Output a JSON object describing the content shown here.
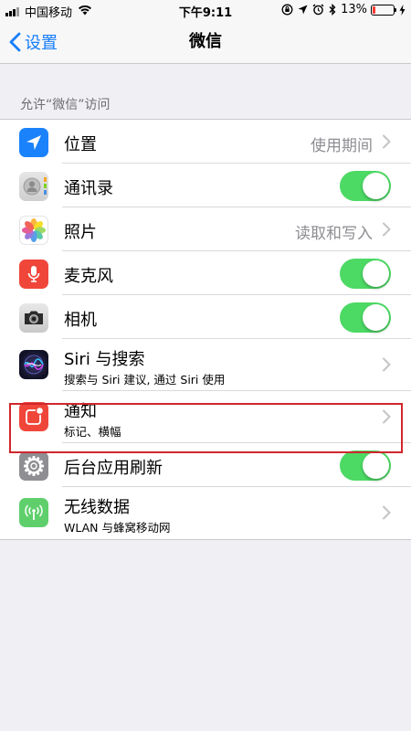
{
  "status_bar": {
    "carrier": "中国移动",
    "time": "下午9:11",
    "battery_percent": "13%",
    "battery_level": 0.13,
    "battery_color": "#ff3b30"
  },
  "nav": {
    "back_label": "设置",
    "title": "微信"
  },
  "section": {
    "header": "允许“微信”访问"
  },
  "rows": [
    {
      "title": "位置",
      "detail": "使用期间",
      "icon": "location-arrow-icon",
      "icon_color": "#1a82fb"
    },
    {
      "title": "通讯录",
      "toggle_on": true,
      "icon": "contacts-icon",
      "icon_color": "#d9d9d9"
    },
    {
      "title": "照片",
      "detail": "读取和写入",
      "icon": "photos-flower-icon",
      "icon_color": "#ffffff"
    },
    {
      "title": "麦克风",
      "toggle_on": true,
      "icon": "microphone-icon",
      "icon_color": "#f0463a"
    },
    {
      "title": "相机",
      "toggle_on": true,
      "icon": "camera-icon",
      "icon_color": "#d6d6d6"
    },
    {
      "title": "Siri 与搜索",
      "subtitle": "搜索与 Siri 建议, 通过 Siri 使用",
      "icon": "siri-icon",
      "icon_color": "#1b1b3a"
    },
    {
      "title": "通知",
      "subtitle": "标记、横幅",
      "icon": "notification-icon",
      "icon_color": "#f0463a"
    },
    {
      "title": "后台应用刷新",
      "toggle_on": true,
      "icon": "gear-icon",
      "icon_color": "#8e8e93"
    },
    {
      "title": "无线数据",
      "subtitle": "WLAN 与蜂窝移动网",
      "icon": "cellular-antenna-icon",
      "icon_color": "#5fcf6c"
    }
  ],
  "colors": {
    "accent": "#157efb",
    "toggle_on": "#4cd964",
    "highlight": "#d0272d"
  }
}
